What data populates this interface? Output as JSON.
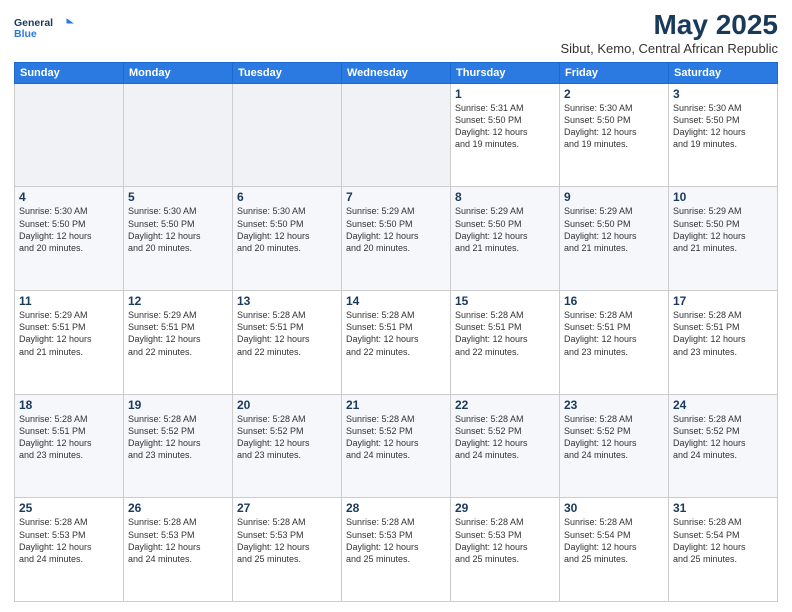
{
  "logo": {
    "line1": "General",
    "line2": "Blue"
  },
  "title": "May 2025",
  "subtitle": "Sibut, Kemo, Central African Republic",
  "days_of_week": [
    "Sunday",
    "Monday",
    "Tuesday",
    "Wednesday",
    "Thursday",
    "Friday",
    "Saturday"
  ],
  "weeks": [
    [
      {
        "day": "",
        "info": ""
      },
      {
        "day": "",
        "info": ""
      },
      {
        "day": "",
        "info": ""
      },
      {
        "day": "",
        "info": ""
      },
      {
        "day": "1",
        "info": "Sunrise: 5:31 AM\nSunset: 5:50 PM\nDaylight: 12 hours\nand 19 minutes."
      },
      {
        "day": "2",
        "info": "Sunrise: 5:30 AM\nSunset: 5:50 PM\nDaylight: 12 hours\nand 19 minutes."
      },
      {
        "day": "3",
        "info": "Sunrise: 5:30 AM\nSunset: 5:50 PM\nDaylight: 12 hours\nand 19 minutes."
      }
    ],
    [
      {
        "day": "4",
        "info": "Sunrise: 5:30 AM\nSunset: 5:50 PM\nDaylight: 12 hours\nand 20 minutes."
      },
      {
        "day": "5",
        "info": "Sunrise: 5:30 AM\nSunset: 5:50 PM\nDaylight: 12 hours\nand 20 minutes."
      },
      {
        "day": "6",
        "info": "Sunrise: 5:30 AM\nSunset: 5:50 PM\nDaylight: 12 hours\nand 20 minutes."
      },
      {
        "day": "7",
        "info": "Sunrise: 5:29 AM\nSunset: 5:50 PM\nDaylight: 12 hours\nand 20 minutes."
      },
      {
        "day": "8",
        "info": "Sunrise: 5:29 AM\nSunset: 5:50 PM\nDaylight: 12 hours\nand 21 minutes."
      },
      {
        "day": "9",
        "info": "Sunrise: 5:29 AM\nSunset: 5:50 PM\nDaylight: 12 hours\nand 21 minutes."
      },
      {
        "day": "10",
        "info": "Sunrise: 5:29 AM\nSunset: 5:50 PM\nDaylight: 12 hours\nand 21 minutes."
      }
    ],
    [
      {
        "day": "11",
        "info": "Sunrise: 5:29 AM\nSunset: 5:51 PM\nDaylight: 12 hours\nand 21 minutes."
      },
      {
        "day": "12",
        "info": "Sunrise: 5:29 AM\nSunset: 5:51 PM\nDaylight: 12 hours\nand 22 minutes."
      },
      {
        "day": "13",
        "info": "Sunrise: 5:28 AM\nSunset: 5:51 PM\nDaylight: 12 hours\nand 22 minutes."
      },
      {
        "day": "14",
        "info": "Sunrise: 5:28 AM\nSunset: 5:51 PM\nDaylight: 12 hours\nand 22 minutes."
      },
      {
        "day": "15",
        "info": "Sunrise: 5:28 AM\nSunset: 5:51 PM\nDaylight: 12 hours\nand 22 minutes."
      },
      {
        "day": "16",
        "info": "Sunrise: 5:28 AM\nSunset: 5:51 PM\nDaylight: 12 hours\nand 23 minutes."
      },
      {
        "day": "17",
        "info": "Sunrise: 5:28 AM\nSunset: 5:51 PM\nDaylight: 12 hours\nand 23 minutes."
      }
    ],
    [
      {
        "day": "18",
        "info": "Sunrise: 5:28 AM\nSunset: 5:51 PM\nDaylight: 12 hours\nand 23 minutes."
      },
      {
        "day": "19",
        "info": "Sunrise: 5:28 AM\nSunset: 5:52 PM\nDaylight: 12 hours\nand 23 minutes."
      },
      {
        "day": "20",
        "info": "Sunrise: 5:28 AM\nSunset: 5:52 PM\nDaylight: 12 hours\nand 23 minutes."
      },
      {
        "day": "21",
        "info": "Sunrise: 5:28 AM\nSunset: 5:52 PM\nDaylight: 12 hours\nand 24 minutes."
      },
      {
        "day": "22",
        "info": "Sunrise: 5:28 AM\nSunset: 5:52 PM\nDaylight: 12 hours\nand 24 minutes."
      },
      {
        "day": "23",
        "info": "Sunrise: 5:28 AM\nSunset: 5:52 PM\nDaylight: 12 hours\nand 24 minutes."
      },
      {
        "day": "24",
        "info": "Sunrise: 5:28 AM\nSunset: 5:52 PM\nDaylight: 12 hours\nand 24 minutes."
      }
    ],
    [
      {
        "day": "25",
        "info": "Sunrise: 5:28 AM\nSunset: 5:53 PM\nDaylight: 12 hours\nand 24 minutes."
      },
      {
        "day": "26",
        "info": "Sunrise: 5:28 AM\nSunset: 5:53 PM\nDaylight: 12 hours\nand 24 minutes."
      },
      {
        "day": "27",
        "info": "Sunrise: 5:28 AM\nSunset: 5:53 PM\nDaylight: 12 hours\nand 25 minutes."
      },
      {
        "day": "28",
        "info": "Sunrise: 5:28 AM\nSunset: 5:53 PM\nDaylight: 12 hours\nand 25 minutes."
      },
      {
        "day": "29",
        "info": "Sunrise: 5:28 AM\nSunset: 5:53 PM\nDaylight: 12 hours\nand 25 minutes."
      },
      {
        "day": "30",
        "info": "Sunrise: 5:28 AM\nSunset: 5:54 PM\nDaylight: 12 hours\nand 25 minutes."
      },
      {
        "day": "31",
        "info": "Sunrise: 5:28 AM\nSunset: 5:54 PM\nDaylight: 12 hours\nand 25 minutes."
      }
    ]
  ]
}
